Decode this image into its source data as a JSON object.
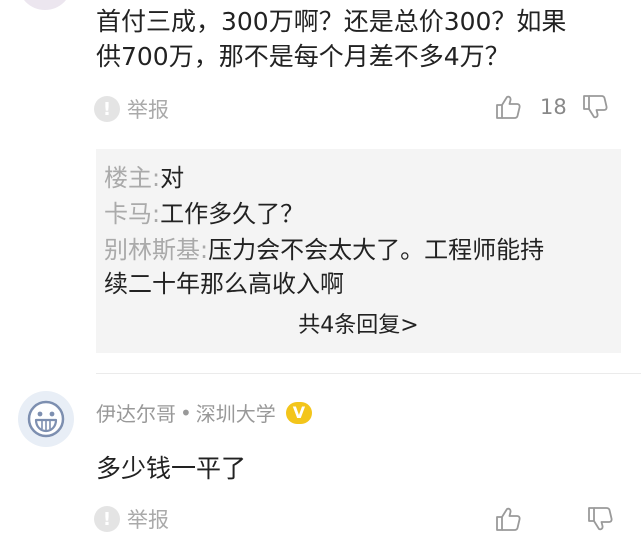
{
  "comment1": {
    "text_lines": [
      "首付三成，300万啊？还是总价300？如果",
      "供700万，那不是每个月差不多4万？"
    ],
    "report_label": "举报",
    "report_glyph": "!",
    "like_count": "18"
  },
  "replies": {
    "items": [
      {
        "name": "楼主:",
        "text": "对"
      },
      {
        "name": "卡马:",
        "text": "工作多久了？"
      },
      {
        "name": "别林斯基:",
        "text": "压力会不会太大了。工程师能持"
      }
    ],
    "continuation": "续二十年那么高收入啊",
    "more_label": "共4条回复>"
  },
  "comment2": {
    "username": "伊达尔哥",
    "separator": "•",
    "school": "深圳大学",
    "badge": "V",
    "text": "多少钱一平了",
    "report_label": "举报",
    "report_glyph": "!"
  },
  "icons": {
    "like": "thumbs-up-icon",
    "dislike": "thumbs-down-icon",
    "report": "report-exclamation-icon",
    "avatar": "smiley-face-icon"
  },
  "colors": {
    "muted_text": "#aaaaaa",
    "reply_background": "#f4f4f4",
    "badge": "#f3c51b",
    "avatar_face": "#7d8fb0"
  }
}
